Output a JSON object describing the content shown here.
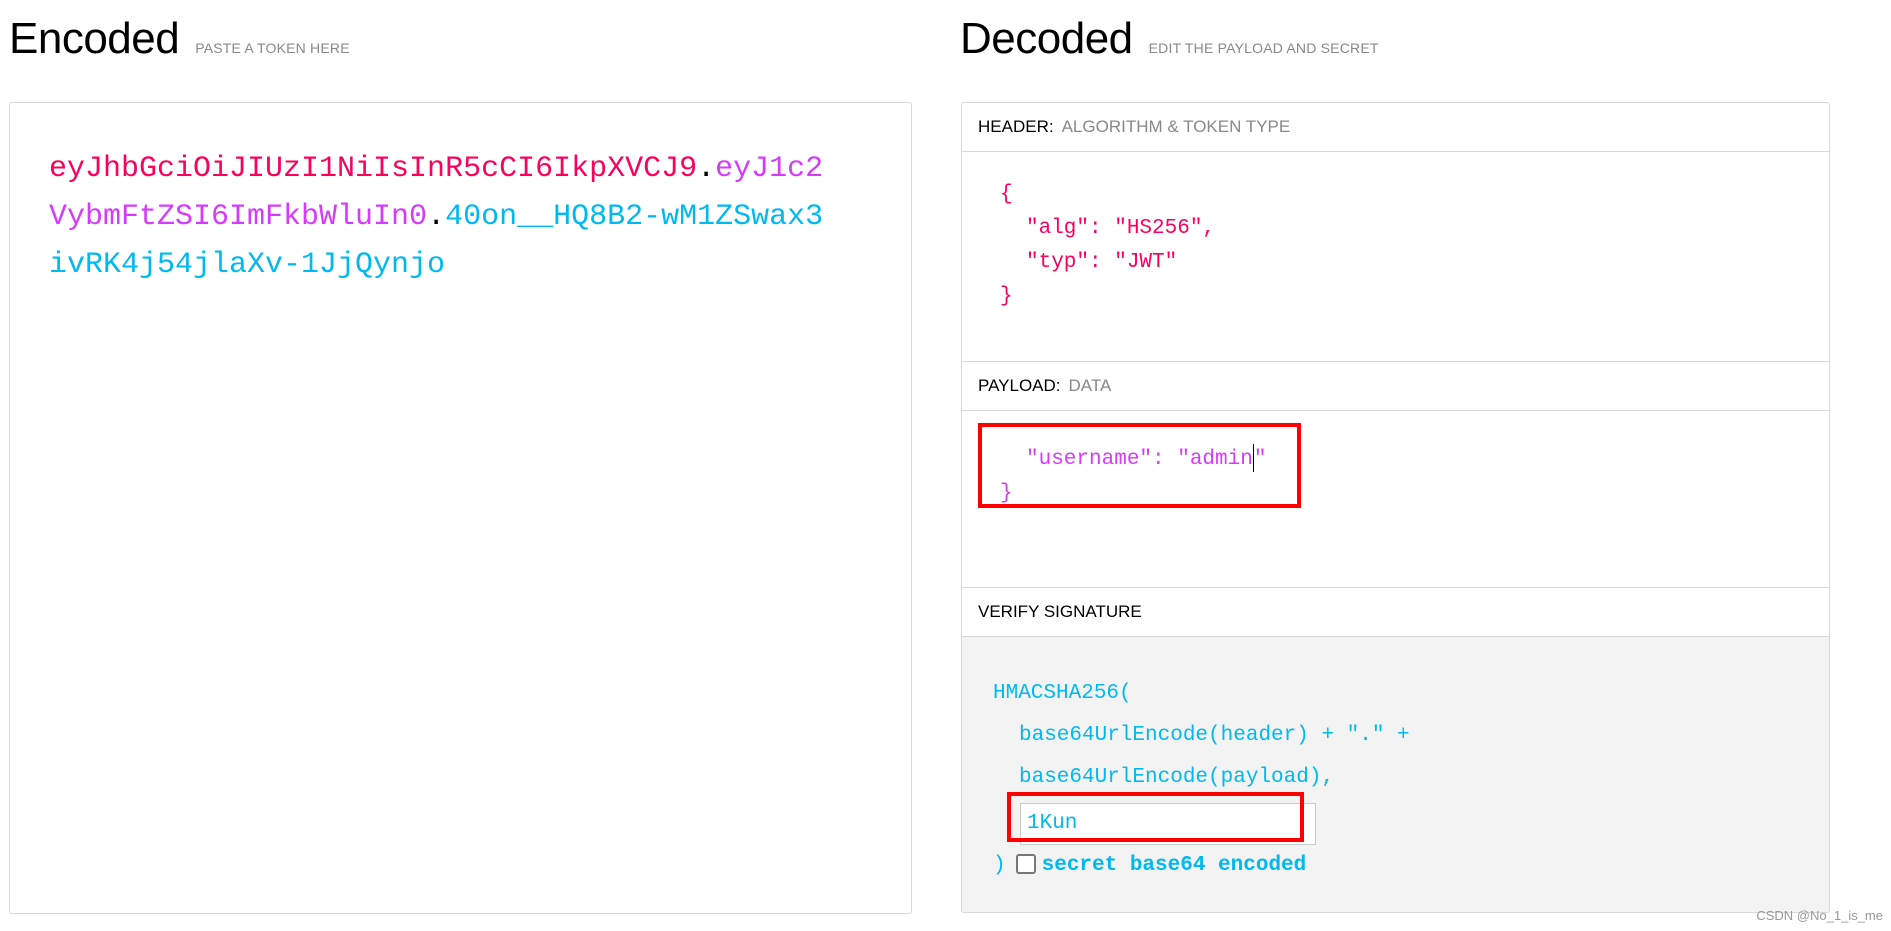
{
  "encoded": {
    "title": "Encoded",
    "subtitle": "PASTE A TOKEN HERE",
    "token": {
      "header": "eyJhbGciOiJIUzI1NiIsInR5cCI6IkpXVCJ9",
      "dot1": ".",
      "payload": "eyJ1c2VybmFtZSI6ImFkbWluIn0",
      "dot2": ".",
      "signature": "40on__HQ8B2-wM1ZSwax3ivRK4j54jlaXv-1JjQynjo"
    }
  },
  "decoded": {
    "title": "Decoded",
    "subtitle": "EDIT THE PAYLOAD AND SECRET",
    "header": {
      "label": "HEADER:",
      "sub": "ALGORITHM & TOKEN TYPE",
      "lines": [
        "{",
        "\"alg\": \"HS256\",",
        "\"typ\": \"JWT\"",
        "}"
      ]
    },
    "payload": {
      "label": "PAYLOAD:",
      "sub": "DATA",
      "lines": [
        "\"username\": \"admin",
        "\"",
        "}"
      ]
    },
    "signature": {
      "label": "VERIFY SIGNATURE",
      "lines": [
        "HMACSHA256(",
        "base64UrlEncode(header) + \".\" +",
        "base64UrlEncode(payload),",
        ")"
      ],
      "secret": "1Kun",
      "checkbox_label": "secret base64 encoded",
      "checked": false
    }
  },
  "watermark": "CSDN @No_1_is_me",
  "colors": {
    "header": "#fb015b",
    "payload": "#d63aff",
    "signature": "#00b9f1",
    "highlight": "#ff0000"
  }
}
